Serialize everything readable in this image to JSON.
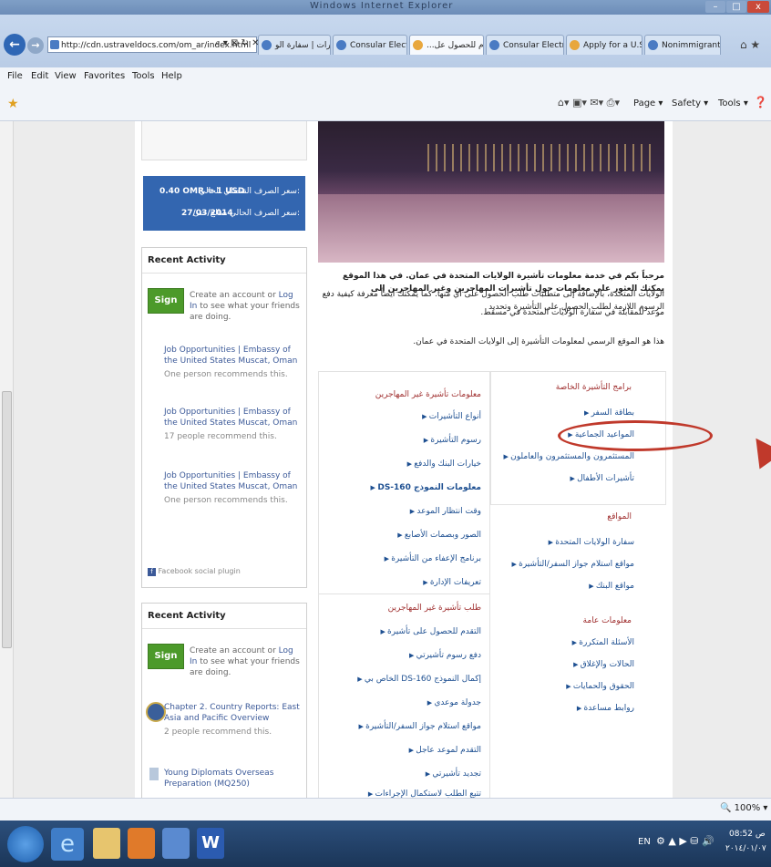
{
  "window": {
    "title": "Windows Internet Explorer"
  },
  "address_bar": {
    "url": "http://cdn.ustraveldocs.com/om_ar/index.html"
  },
  "tabs": [
    {
      "label": "تأشيرات | سفارة الو..."
    },
    {
      "label": "Consular Electroni..."
    },
    {
      "label": "...التقدم للحصول عل"
    },
    {
      "label": "Consular Electroni..."
    },
    {
      "label": "Apply for a U.S. Vis..."
    },
    {
      "label": "Nonimmigrant Vis..."
    }
  ],
  "menu": [
    "File",
    "Edit",
    "View",
    "Favorites",
    "Tools",
    "Help"
  ],
  "commandbar": {
    "page": "Page ▾",
    "safety": "Safety ▾",
    "tools": "Tools ▾"
  },
  "exchange": {
    "rate_label": "سعر الصرف القنصلي الحالي:",
    "rate_value": "0.40 OMR = 1 USD",
    "date_label": "سعر الصرف الحالي صالح حتى:",
    "date_value": "27/03/2014"
  },
  "widgets": [
    {
      "header": "Recent Activity",
      "signup": "Sign Up",
      "text_pre": "Create an account or ",
      "login": "Log In",
      "text_post": " to see what your friends are doing.",
      "items": [
        {
          "title": "Job Opportunities | Embassy of the United States Muscat, Oman",
          "sub": "One person recommends this."
        },
        {
          "title": "Job Opportunities | Embassy of the United States Muscat, Oman",
          "sub": "17 people recommend this."
        },
        {
          "title": "Job Opportunities | Embassy of the United States Muscat, Oman",
          "sub": "One person recommends this."
        }
      ],
      "footer": "Facebook social plugin"
    },
    {
      "header": "Recent Activity",
      "signup": "Sign Up",
      "text_pre": "Create an account or ",
      "login": "Log In",
      "text_post": " to see what your friends are doing.",
      "items": [
        {
          "title": "Chapter 2. Country Reports: East Asia and Pacific Overview",
          "sub": "2 people recommend this."
        },
        {
          "title": "Young Diplomats Overseas Preparation (MQ250)",
          "sub": ""
        }
      ]
    }
  ],
  "welcome": {
    "line1": "مرحباً بكم في خدمة معلومات تأشيرة الولايات المتحدة في عمان. في هذا الموقع يمكنك العثور على معلومات حول تأشيرات المهاجرين وغير المهاجرين إلى",
    "line2": "الولايات المتحدة، بالإضافة إلى متطلبات طلب الحصول على أي منها. كما يمكنك أيضاً معرفة كيفية دفع الرسوم اللازمة لطلب الحصول على التأشيرة وتحديد",
    "line3": "موعد للمقابلة في سفارة الولايات المتحدة في مسقط.",
    "line4": "هذا هو الموقع الرسمي لمعلومات التأشيرة إلى الولايات المتحدة في عمان."
  },
  "sections": {
    "special": {
      "title": "برامج التأشيرة الخاصة",
      "links": [
        "بطاقة السفر",
        "المواعيد الجماعية",
        "المستثمرون والمستثمرون والعاملون",
        "تأشيرات الأطفال"
      ]
    },
    "location": {
      "title": "المواقع",
      "links": [
        "سفارة الولايات المتحدة",
        "مواقع استلام جواز السفر/التأشيرة",
        "مواقع البنك"
      ]
    },
    "general": {
      "title": "معلومات عامة",
      "links": [
        "الأسئلة المتكررة",
        "الحالات والإغلاق",
        "الحقوق والحمايات",
        "روابط مساعدة"
      ]
    },
    "nonimmigrant_info": {
      "title": "معلومات تأشيرة غير المهاجرين",
      "links": [
        "أنواع التأشيرات",
        "رسوم التأشيرة",
        "خيارات البنك والدفع",
        "معلومات النموذج DS-160",
        "وقت انتظار الموعد",
        "الصور وبصمات الأصابع",
        "برنامج الإعفاء من التأشيرة",
        "تعريفات الإدارة"
      ]
    },
    "nonimmigrant_apply": {
      "title": "طلب تأشيرة غير المهاجرين",
      "links": [
        "التقدم للحصول على تأشيرة",
        "دفع رسوم تأشيرتي",
        "إكمال النموذج DS-160 الخاص بي",
        "جدولة موعدي",
        "مواقع استلام جواز السفر/التأشيرة",
        "التقدم لموعد عاجل",
        "تجديد تأشيرتي",
        "تتبع الطلب لاستكمال الإجراءات"
      ]
    }
  },
  "status": {
    "zoom": "100%"
  },
  "taskbar": {
    "lang": "EN",
    "time": "08:52 ص",
    "date": "٢٠١٤/٠١/٠٧"
  },
  "colors": {
    "accent": "#3366b0",
    "annotation": "#c0392b",
    "signup": "#4c9a2a"
  }
}
